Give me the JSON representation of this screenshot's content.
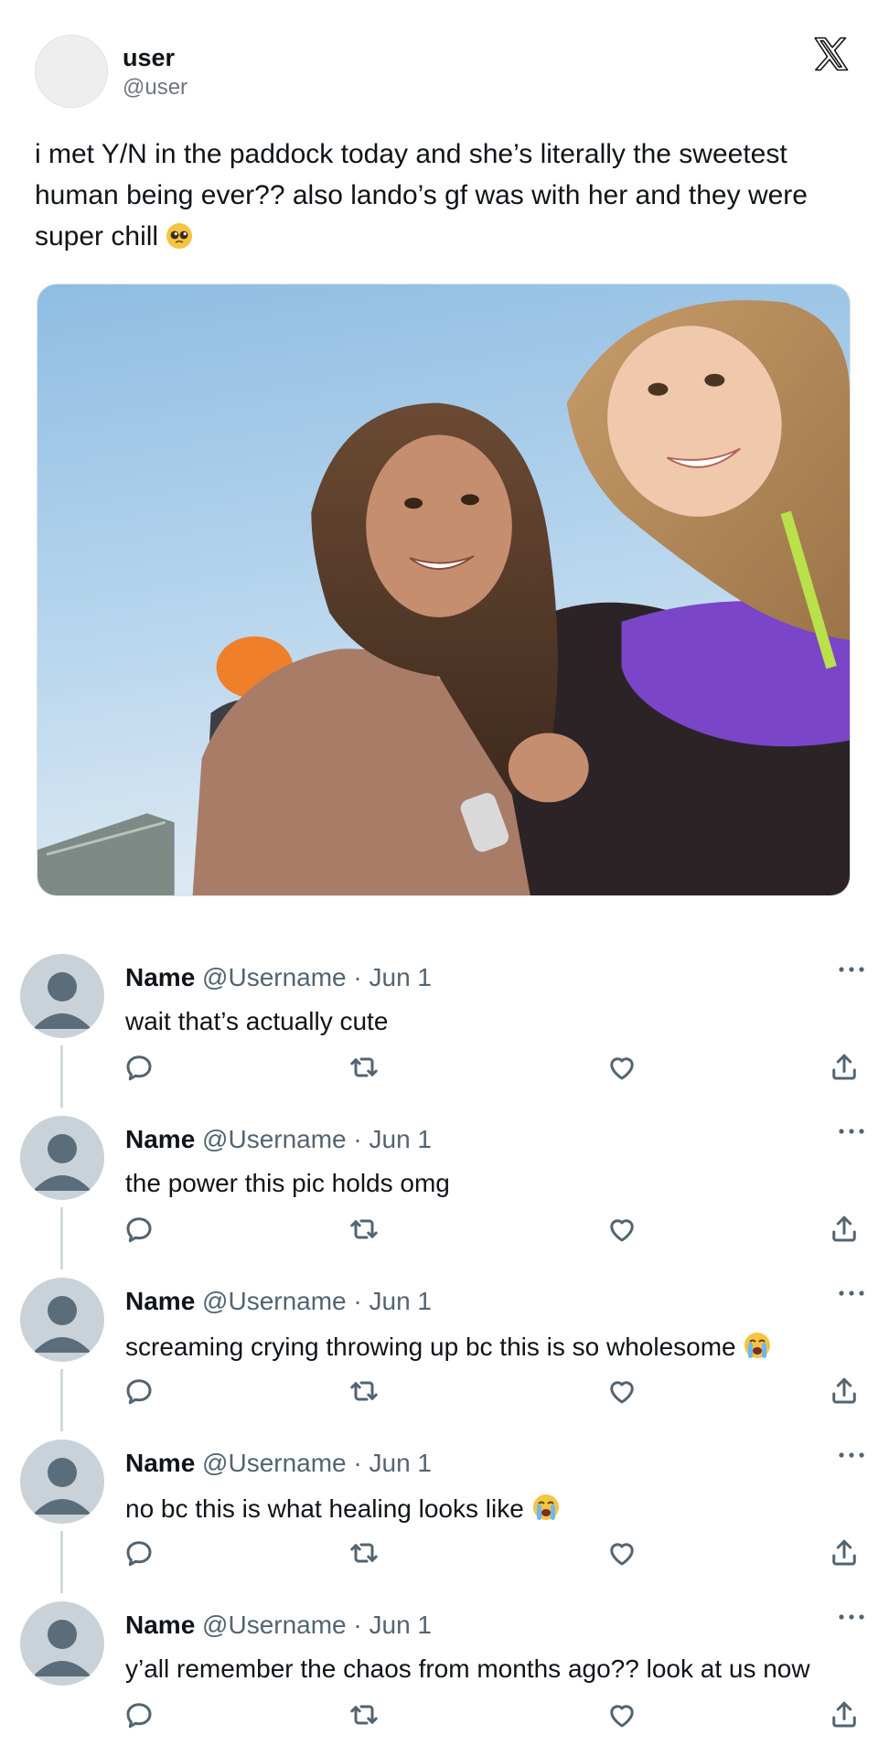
{
  "post": {
    "author_name": "user",
    "author_handle": "@user",
    "text": "i met Y/N in the paddock today and she’s literally the sweetest human being ever?? also lando’s gf was with her and they were super chill",
    "text_emoji": "pleading-face",
    "photo": "selfie of two smiling women at a racetrack paddock"
  },
  "brand": {
    "logo": "x-logo-icon"
  },
  "replies": [
    {
      "name": "Name",
      "meta": "@Username · Jun 1",
      "text": "wait that’s actually cute",
      "emoji": ""
    },
    {
      "name": "Name",
      "meta": "@Username · Jun 1",
      "text": "the power this pic holds omg",
      "emoji": ""
    },
    {
      "name": "Name",
      "meta": "@Username · Jun 1",
      "text": "screaming crying throwing up bc this is so wholesome",
      "emoji": "loudly-crying-face"
    },
    {
      "name": "Name",
      "meta": "@Username · Jun 1",
      "text": "no bc this is what healing looks like",
      "emoji": "loudly-crying-face"
    },
    {
      "name": "Name",
      "meta": "@Username · Jun 1",
      "text": "y’all remember the chaos from months ago?? look at us now",
      "emoji": ""
    }
  ],
  "icons": {
    "reply": "speech-bubble-icon",
    "retweet": "retweet-icon",
    "like": "heart-icon",
    "share": "share-icon",
    "more": "more-dots-icon"
  },
  "colors": {
    "text": "#0f1419",
    "secondary": "#536471",
    "thread_line": "#cfd9de",
    "avatar_placeholder": "#c9d2d8"
  }
}
